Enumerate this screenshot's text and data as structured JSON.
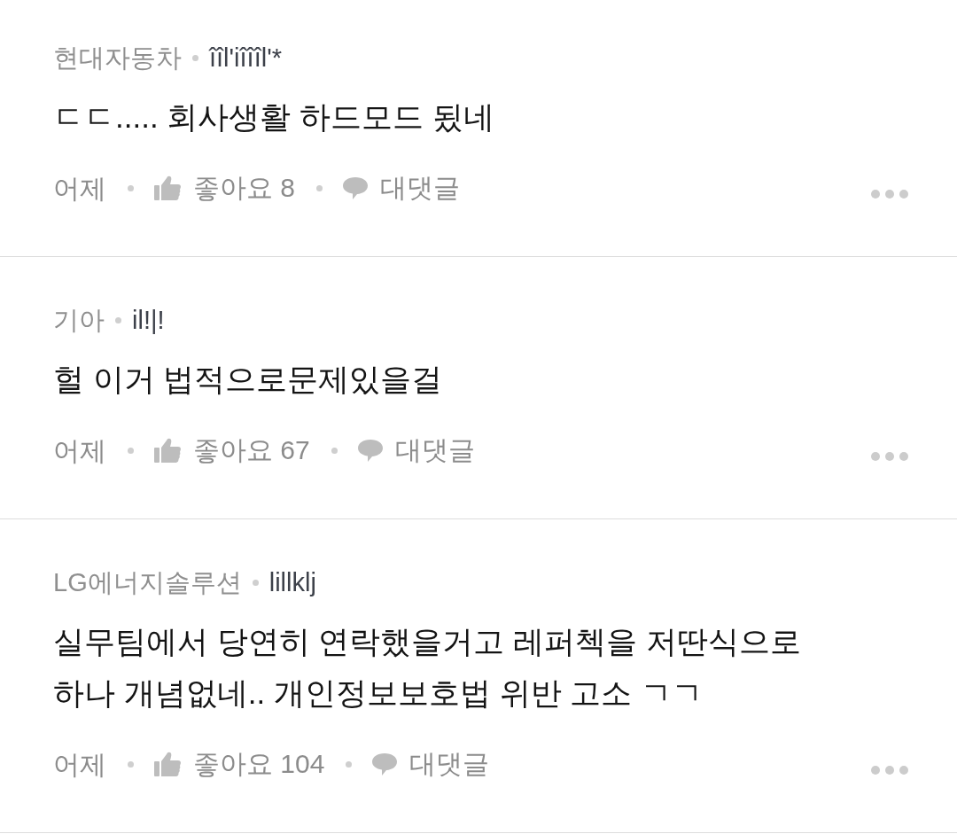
{
  "comments": [
    {
      "company": "현대자동차",
      "nickname": "îîl'iîîîl'*",
      "body": "ㄷㄷ..... 회사생활 하드모드 됬네",
      "time": "어제",
      "like_label": "좋아요 8",
      "reply_label": "대댓글"
    },
    {
      "company": "기아",
      "nickname": "il!|!",
      "body": "헐 이거 법적으로문제있을걸",
      "time": "어제",
      "like_label": "좋아요 67",
      "reply_label": "대댓글"
    },
    {
      "company": "LG에너지솔루션",
      "nickname": "lillklj",
      "body": "실무팀에서 당연히 연락했을거고 레퍼첵을 저딴식으로 하나 개념없네.. 개인정보보호법 위반 고소 ㄱㄱ",
      "time": "어제",
      "like_label": "좋아요 104",
      "reply_label": "대댓글"
    }
  ]
}
